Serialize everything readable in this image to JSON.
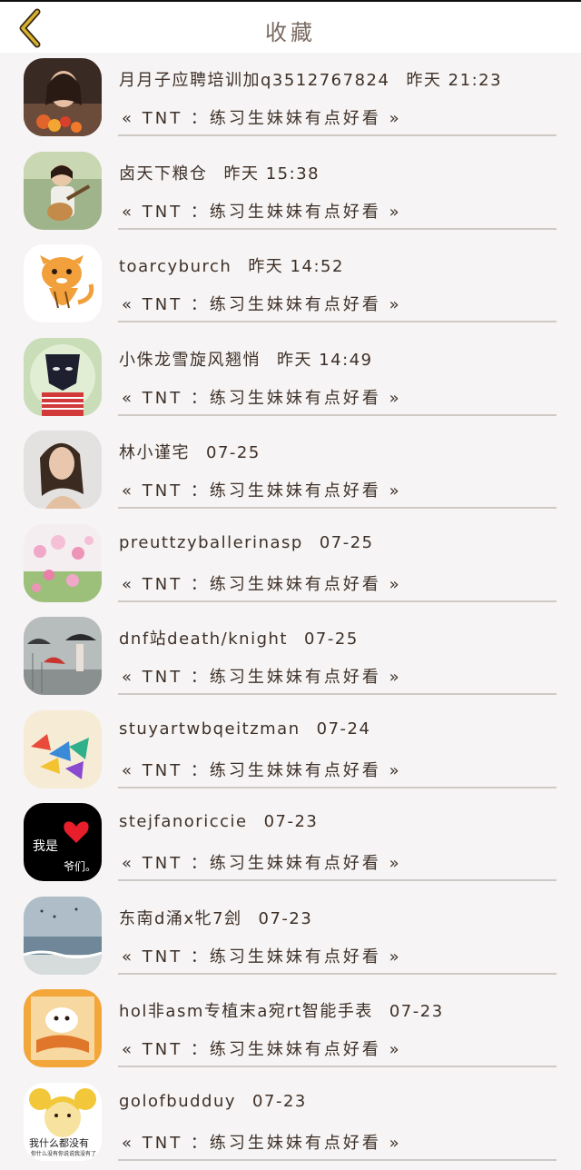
{
  "header": {
    "title": "收藏",
    "back_icon": "chevron-left-icon",
    "accent": "#c9a227"
  },
  "favorites": [
    {
      "name": "月月子应聘培训加q3512767824",
      "time": "昨天 21:23",
      "quote": "« TNT ：练习生妹妹有点好看 »",
      "avatar": "photo-girl-flowers"
    },
    {
      "name": "卤天下粮仓",
      "time": "昨天 15:38",
      "quote": "« TNT ：练习生妹妹有点好看 »",
      "avatar": "photo-girl-guitar"
    },
    {
      "name": "toarcyburch",
      "time": "昨天 14:52",
      "quote": "« TNT ：练习生妹妹有点好看 »",
      "avatar": "cartoon-tiger"
    },
    {
      "name": "小侏龙雪旋风翘悄",
      "time": "昨天 14:49",
      "quote": "« TNT ：练习生妹妹有点好看 »",
      "avatar": "illustration-masked-figure"
    },
    {
      "name": "林小谨宅",
      "time": "07-25",
      "quote": "« TNT ：练习生妹妹有点好看 »",
      "avatar": "photo-woman-portrait"
    },
    {
      "name": "preuttzyballerinasp",
      "time": "07-25",
      "quote": "« TNT ：练习生妹妹有点好看 »",
      "avatar": "photo-pink-flowers"
    },
    {
      "name": "dnf站death/knight",
      "time": "07-25",
      "quote": "« TNT ：练习生妹妹有点好看 »",
      "avatar": "illustration-rain-umbrella"
    },
    {
      "name": "stuyartwbqeitzman",
      "time": "07-24",
      "quote": "« TNT ：练习生妹妹有点好看 »",
      "avatar": "photo-paper-cranes"
    },
    {
      "name": "stejfanoriccie",
      "time": "07-23",
      "quote": "« TNT ：练习生妹妹有点好看 »",
      "avatar": "text-black-heart",
      "avatar_text_1": "我是",
      "avatar_text_2": "爷们。"
    },
    {
      "name": "东南d涌x牝7刽",
      "time": "07-23",
      "quote": "« TNT ：练习生妹妹有点好看 »",
      "avatar": "photo-seaside"
    },
    {
      "name": "hol非asm专植末a宛rt智能手表",
      "time": "07-23",
      "quote": "« TNT ：练习生妹妹有点好看 »",
      "avatar": "cartoon-bear-orange"
    },
    {
      "name": "golofbudduy",
      "time": "07-23",
      "quote": "« TNT ：练习生妹妹有点好看 »",
      "avatar": "meme-cartoon-girl",
      "avatar_text_1": "我什么都没有",
      "avatar_text_2": "你什么没有你说说我没有了"
    }
  ]
}
